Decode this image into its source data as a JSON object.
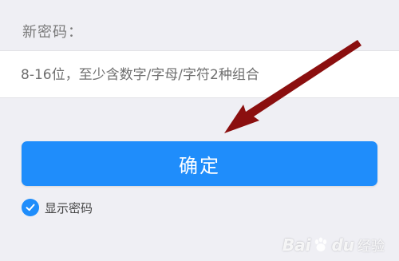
{
  "form": {
    "section_label": "新密码：",
    "password_placeholder": "8-16位，至少含数字/字母/字符2种组合",
    "password_value": ""
  },
  "confirm_button": {
    "label": "确定"
  },
  "show_password": {
    "label": "显示密码",
    "checked": true
  },
  "watermark": {
    "brand": "Bai",
    "brand_suffix": "du",
    "product": "经验"
  },
  "colors": {
    "background": "#efeff4",
    "accent": "#1f8dfb",
    "annotation_arrow": "#8b0f0f"
  },
  "icons": {
    "checkbox": "check-circle-icon",
    "annotation": "pointer-arrow-icon",
    "watermark_mark": "paw-icon"
  }
}
